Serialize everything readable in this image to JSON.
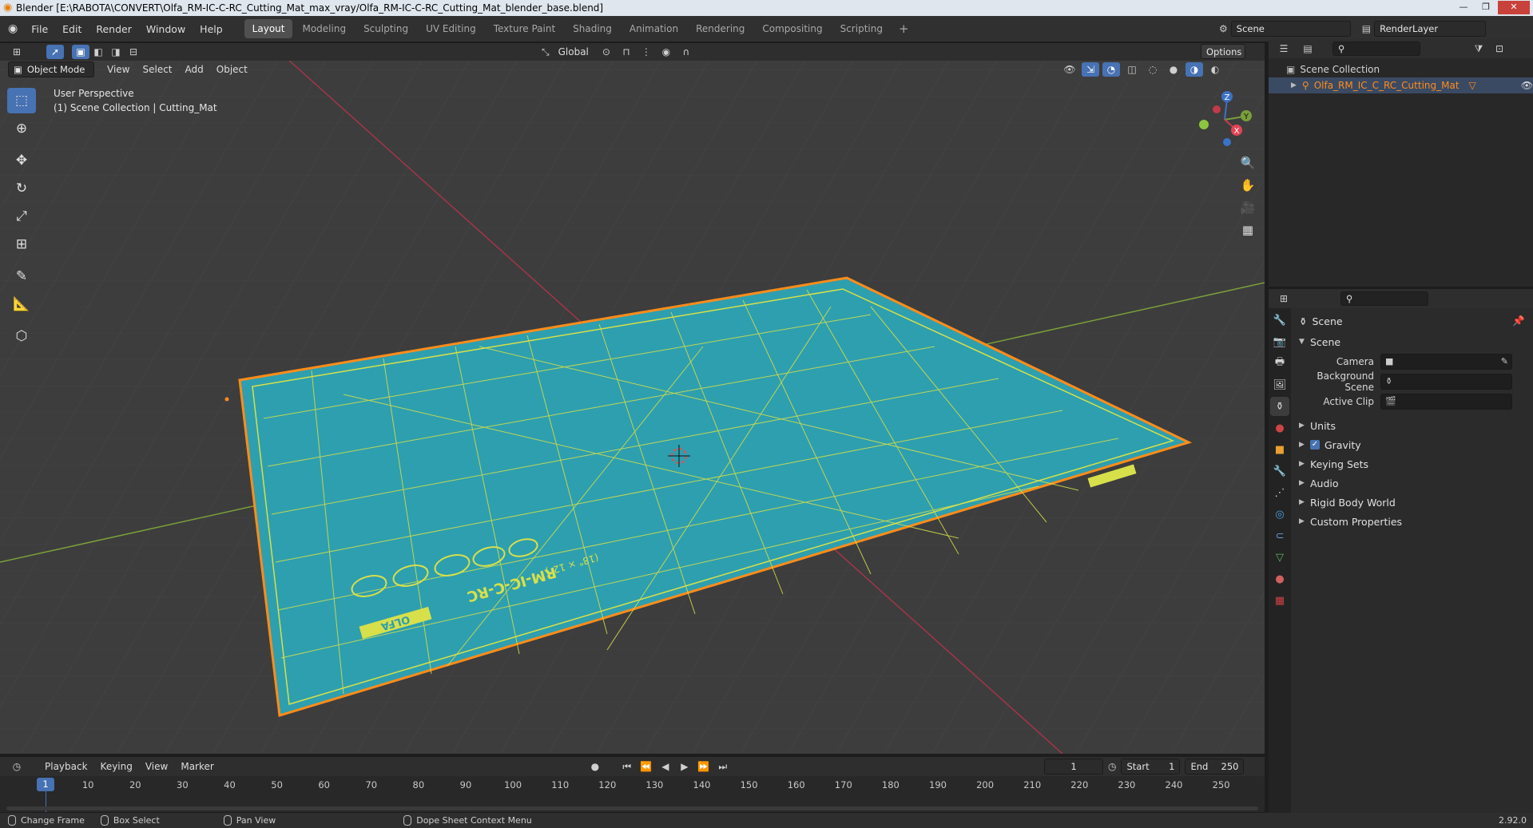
{
  "window": {
    "title": "Blender [E:\\RABOTA\\CONVERT\\Olfa_RM-IC-C-RC_Cutting_Mat_max_vray/Olfa_RM-IC-C-RC_Cutting_Mat_blender_base.blend]",
    "minimize": "—",
    "maximize": "❐",
    "close": "✕"
  },
  "menu": [
    "File",
    "Edit",
    "Render",
    "Window",
    "Help"
  ],
  "workspaces": [
    "Layout",
    "Modeling",
    "Sculpting",
    "UV Editing",
    "Texture Paint",
    "Shading",
    "Animation",
    "Rendering",
    "Compositing",
    "Scripting"
  ],
  "workspace_add": "+",
  "scene_field": "Scene",
  "renderlayer_field": "RenderLayer",
  "viewport": {
    "mode": "Object Mode",
    "menus": [
      "View",
      "Select",
      "Add",
      "Object"
    ],
    "transform_orientation": "Global",
    "options": "Options",
    "info_line1": "User Perspective",
    "info_line2": "(1) Scene Collection | Cutting_Mat",
    "gizmo": {
      "x": "X",
      "y": "Y",
      "z": "Z"
    }
  },
  "mat": {
    "brand": "OLFA",
    "model": "RM-IC-C-RC",
    "size": "(18\" × 12\")",
    "tag": "RM-IC-C"
  },
  "colors": {
    "mat": "#2e9fae",
    "grid_lines": "#d7e04a",
    "selection_outline": "#ff8c1a",
    "active_blue": "#4772b3",
    "x_axis": "#a3354a",
    "y_axis": "#7a9f3a"
  },
  "outliner": {
    "root": "Scene Collection",
    "object": "Olfa_RM_IC_C_RC_Cutting_Mat"
  },
  "properties": {
    "context": "Scene",
    "panel": "Scene",
    "rows": [
      {
        "label": "Camera",
        "value": ""
      },
      {
        "label": "Background Scene",
        "value": ""
      },
      {
        "label": "Active Clip",
        "value": ""
      }
    ],
    "subpanels": [
      "Units",
      "Gravity",
      "Keying Sets",
      "Audio",
      "Rigid Body World",
      "Custom Properties"
    ]
  },
  "timeline": {
    "menus": [
      "Playback",
      "Keying",
      "View",
      "Marker"
    ],
    "current_frame": "1",
    "start_label": "Start",
    "start": "1",
    "end_label": "End",
    "end": "250",
    "ticks": [
      "1",
      "10",
      "20",
      "30",
      "40",
      "50",
      "60",
      "70",
      "80",
      "90",
      "100",
      "110",
      "120",
      "130",
      "140",
      "150",
      "160",
      "170",
      "180",
      "190",
      "200",
      "210",
      "220",
      "230",
      "240",
      "250"
    ]
  },
  "status": {
    "items": [
      "Change Frame",
      "Box Select",
      "Pan View",
      "Dope Sheet Context Menu"
    ],
    "version": "2.92.0"
  }
}
